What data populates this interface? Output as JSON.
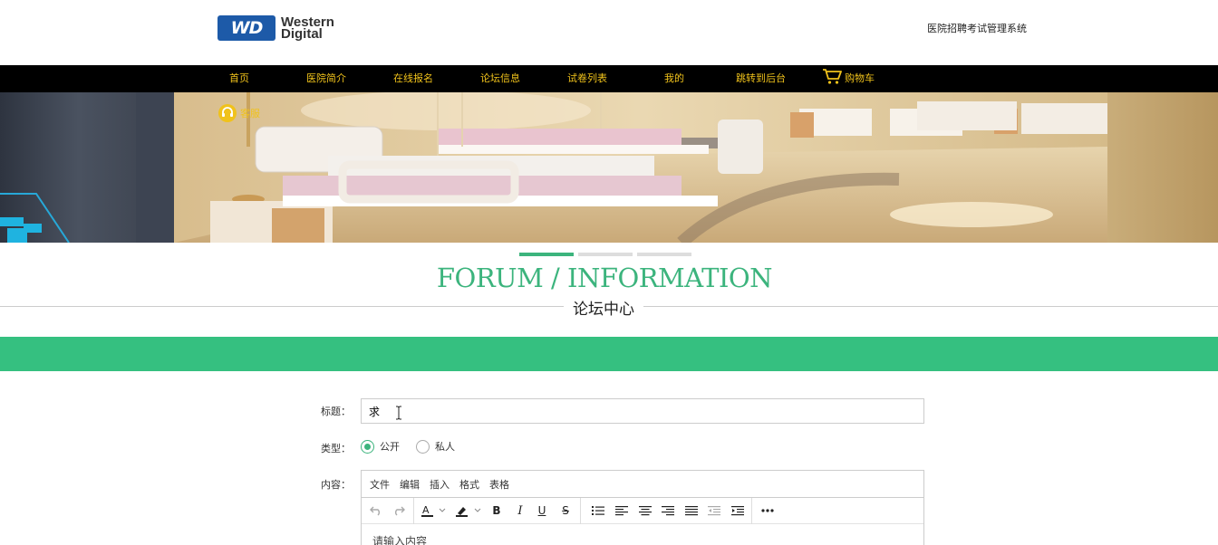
{
  "header": {
    "logo_line1": "Western",
    "logo_line2": "Digital",
    "logo_badge": "WD",
    "system_title": "医院招聘考试管理系统"
  },
  "nav": {
    "items": [
      {
        "label": "首页"
      },
      {
        "label": "医院简介"
      },
      {
        "label": "在线报名"
      },
      {
        "label": "论坛信息"
      },
      {
        "label": "试卷列表"
      },
      {
        "label": "我的"
      },
      {
        "label": "跳转到后台"
      },
      {
        "label": "购物车"
      }
    ]
  },
  "banner": {
    "kefu_label": "客服",
    "slides": 3,
    "active_slide": 1
  },
  "section": {
    "title_en": "FORUM / INFORMATION",
    "title_cn": "论坛中心"
  },
  "form": {
    "title_label": "标题：",
    "title_value": "求",
    "type_label": "类型：",
    "type_options": [
      {
        "label": "公开",
        "checked": true
      },
      {
        "label": "私人",
        "checked": false
      }
    ],
    "content_label": "内容：",
    "editor_menu": [
      "文件",
      "编辑",
      "插入",
      "格式",
      "表格"
    ],
    "editor_placeholder": "请输入内容"
  },
  "colors": {
    "accent_green": "#35c080",
    "nav_bg": "#000000",
    "nav_text": "#f0c21b",
    "logo_blue": "#1d5aa8"
  },
  "icons": {
    "cart": "cart-icon",
    "kefu": "headset-icon"
  }
}
